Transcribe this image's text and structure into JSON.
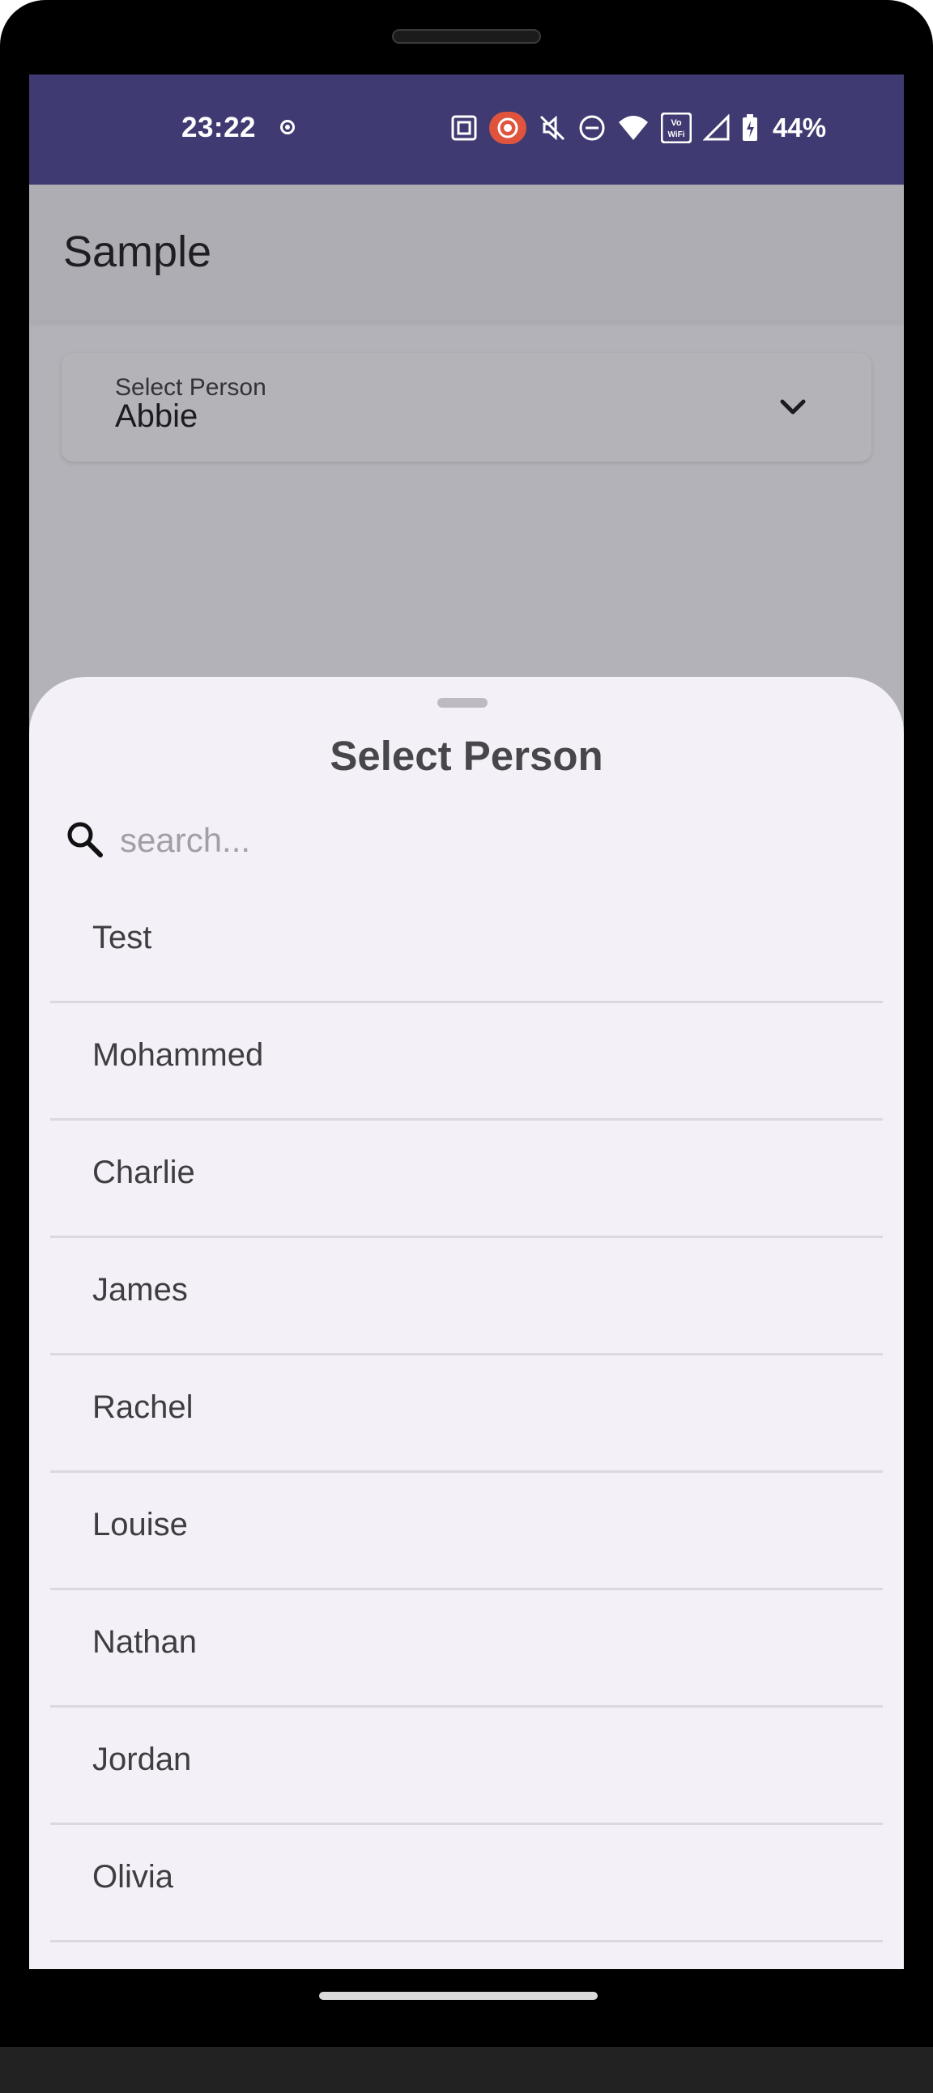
{
  "status_bar": {
    "time": "23:22",
    "battery": "44%",
    "icons": [
      "record-dot-icon",
      "nfc-icon",
      "screen-record-icon",
      "mute-icon",
      "do-not-disturb-icon",
      "wifi-icon",
      "vowifi-icon",
      "signal-icon",
      "battery-icon"
    ],
    "vowifi_label": "Vo WiFi"
  },
  "app": {
    "title": "Sample"
  },
  "dropdown": {
    "label": "Select Person",
    "value": "Abbie"
  },
  "sheet": {
    "title": "Select Person",
    "search_placeholder": "search...",
    "items": [
      "Test",
      "Mohammed",
      "Charlie",
      "James",
      "Rachel",
      "Louise",
      "Nathan",
      "Jordan",
      "Olivia"
    ]
  },
  "colors": {
    "status_bar": "#3f3a71",
    "sheet_background": "#f4f0f7",
    "scrim": "#b3b2b8"
  }
}
